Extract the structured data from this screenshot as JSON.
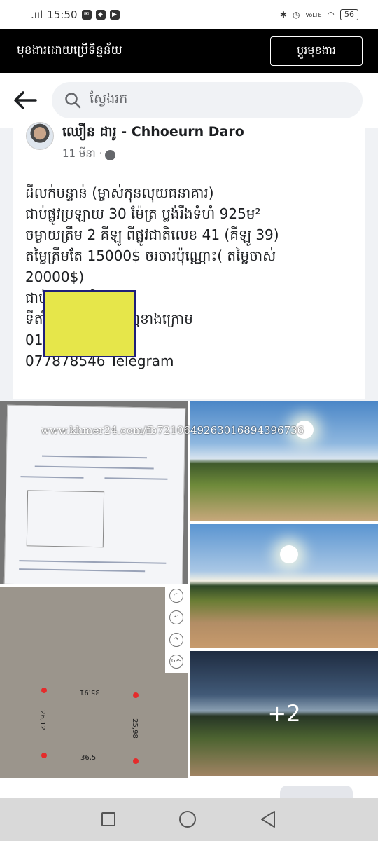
{
  "status": {
    "time": "15:50",
    "signal": ".ııl",
    "volte": "VoLTE",
    "battery": "56"
  },
  "banner": {
    "text": "មុខងារដោយប្រើទិន្នន័យ",
    "button_label": "ប្ដូរមុខងារ"
  },
  "search": {
    "placeholder": "ស្វែងរក"
  },
  "post": {
    "author": "ឈឿន ដារូ - Chhoeurn Daro",
    "time": "11 មីនា ·",
    "lines": [
      "ដីលក់បន្ទាន់ (ម្ចាស់កុនលុយធនាគារ)",
      "ជាប់ផ្លូវប្រឡាយ 30 ម៉ែត្រ ប្លង់រឹងទំហំ 925ម²",
      "ចម្ងាយត្រឹម 2 គីឡូ ពីផ្លូវជាតិលេខ 41 (គីឡូ 39)",
      "តម្លៃត្រឹមតែ 15000$ ចរចារប៉ុណ្ណោះ( តម្លៃចាស់",
      "20000$)",
      "ជាប់ផ្ទះអ្នកភូមិ",
      "ទីតាំងភូមិ នៅលើបណ្ណខាងក្រោម",
      "010878546",
      "077878546 Telegram"
    ]
  },
  "gallery": {
    "watermark": "www.khmer24.com/fb7210649263016894396736",
    "more_count": "+2",
    "plot_labels": {
      "top": "35,91",
      "left": "26,12",
      "right": "25,98",
      "bottom": "36,5"
    }
  },
  "colors": {
    "banner_bg": "#000000",
    "plot_fill": "#e6e64a",
    "plot_border": "#1f1f7a",
    "plot_corner": "#e52b2b"
  },
  "icons": {
    "back": "arrow-left-icon",
    "search": "search-icon",
    "globe": "globe-icon"
  }
}
